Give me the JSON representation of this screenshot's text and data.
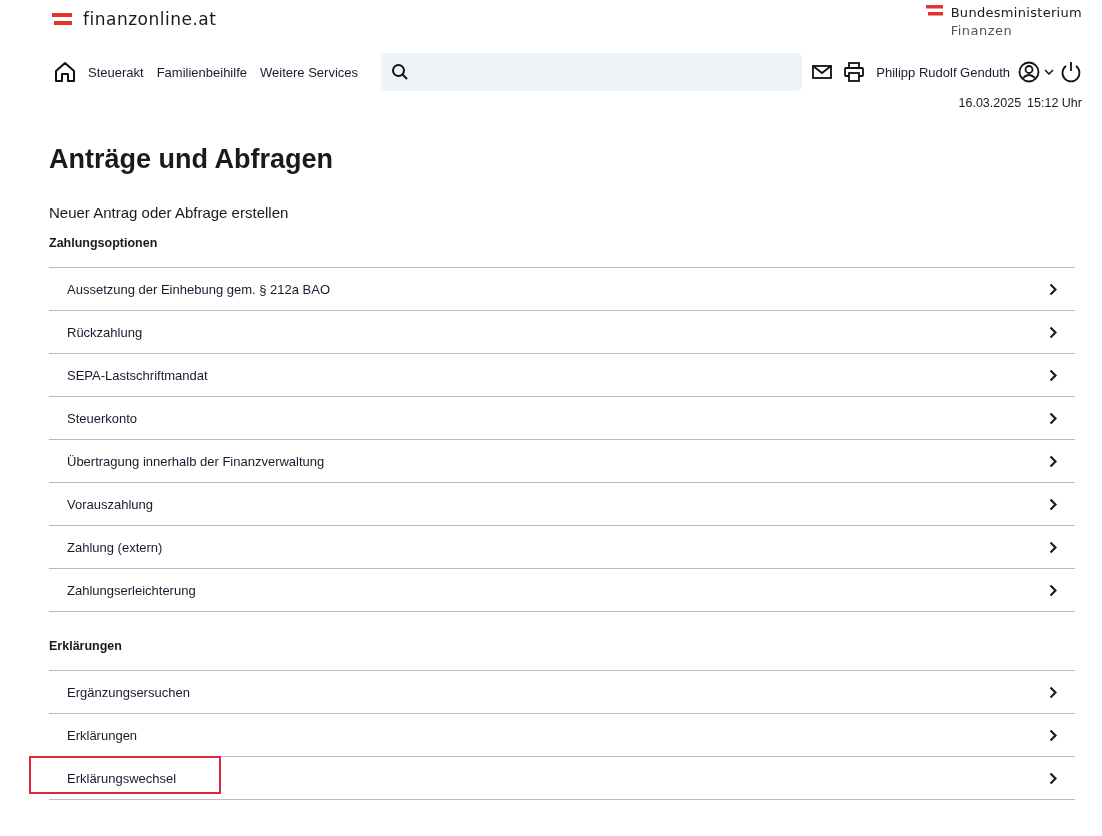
{
  "header": {
    "site_name": "finanzonline.at",
    "ministry_name": "Bundesministerium",
    "ministry_sub": "Finanzen"
  },
  "nav": {
    "links": [
      "Steuerakt",
      "Familienbeihilfe",
      "Weitere Services"
    ],
    "user_name": "Philipp Rudolf Genduth",
    "datetime": [
      "16.03.2025",
      "15:12 Uhr"
    ]
  },
  "page": {
    "title": "Anträge und Abfragen",
    "subtitle": "Neuer Antrag oder Abfrage erstellen"
  },
  "sections": [
    {
      "heading": "Zahlungsoptionen",
      "items": [
        {
          "label": "Aussetzung der Einhebung gem. § 212a BAO",
          "highlighted": false
        },
        {
          "label": "Rückzahlung",
          "highlighted": false
        },
        {
          "label": "SEPA-Lastschriftmandat",
          "highlighted": false
        },
        {
          "label": "Steuerkonto",
          "highlighted": false
        },
        {
          "label": "Übertragung innerhalb der Finanzverwaltung",
          "highlighted": false
        },
        {
          "label": "Vorauszahlung",
          "highlighted": false
        },
        {
          "label": "Zahlung (extern)",
          "highlighted": false
        },
        {
          "label": "Zahlungserleichterung",
          "highlighted": false
        }
      ]
    },
    {
      "heading": "Erklärungen",
      "items": [
        {
          "label": "Ergänzungsersuchen",
          "highlighted": false
        },
        {
          "label": "Erklärungen",
          "highlighted": false
        },
        {
          "label": "Erklärungswechsel",
          "highlighted": true
        }
      ]
    }
  ]
}
